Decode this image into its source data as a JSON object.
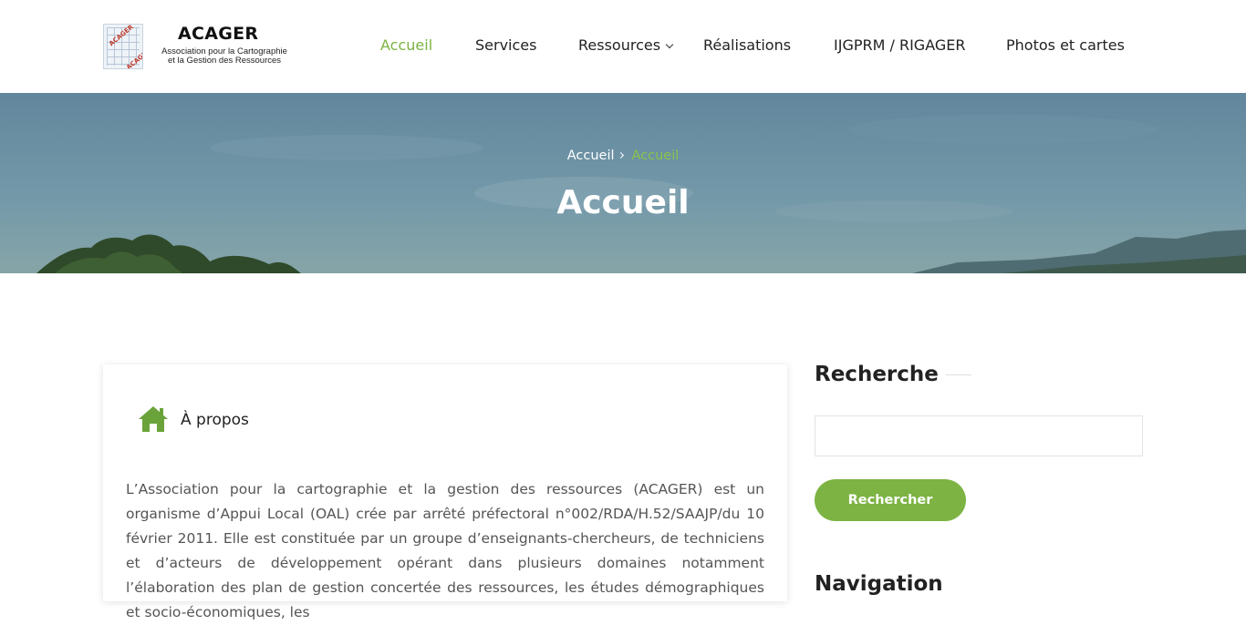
{
  "header": {
    "logo": {
      "title": "ACAGER",
      "subtitle_line1": "Association pour la Cartographie",
      "subtitle_line2": "et la Gestion des Ressources",
      "stamp": "ACAGER"
    },
    "nav": [
      {
        "label": "Accueil",
        "active": true
      },
      {
        "label": "Services",
        "active": false
      },
      {
        "label": "Ressources",
        "active": false,
        "has_dropdown": true
      },
      {
        "label": "Réalisations",
        "active": false
      },
      {
        "label": "IJGPRM / RIGAGER",
        "active": false
      },
      {
        "label": "Photos et cartes",
        "active": false
      }
    ]
  },
  "banner": {
    "breadcrumb": {
      "home": "Accueil",
      "current": "Accueil"
    },
    "title": "Accueil"
  },
  "about": {
    "icon": "home-icon",
    "title": "À propos",
    "text": "L’Association pour la cartographie et la gestion des ressources (ACAGER) est un organisme d’Appui Local (OAL) crée par arrêté préfectoral n°002/RDA/H.52/SAAJP/du 10 février 2011. Elle est constituée par un groupe d’enseignants-chercheurs, de techniciens et d’acteurs de développement opérant dans plusieurs domaines notamment l’élaboration des plan de gestion concertée des ressources, les études démographiques et socio-économiques, les"
  },
  "sidebar": {
    "search_title": "Recherche",
    "search_placeholder": "",
    "search_button": "Rechercher",
    "navigation_title": "Navigation"
  },
  "colors": {
    "accent": "#7cb342",
    "text": "#222222",
    "body_text": "#555555"
  }
}
